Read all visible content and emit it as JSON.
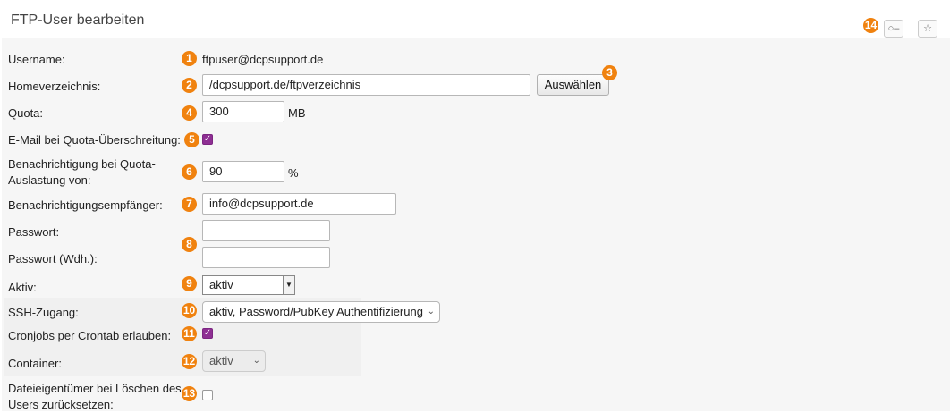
{
  "header": {
    "title": "FTP-User bearbeiten",
    "badge_14": "14"
  },
  "form": {
    "username": {
      "label": "Username:",
      "badge": "1",
      "value": "ftpuser@dcpsupport.de"
    },
    "home": {
      "label": "Homeverzeichnis:",
      "badge": "2",
      "value": "/dcpsupport.de/ftpverzeichnis",
      "button": "Auswählen",
      "button_badge": "3"
    },
    "quota": {
      "label": "Quota:",
      "badge": "4",
      "value": "300",
      "unit": "MB"
    },
    "quota_mail": {
      "label": "E-Mail bei Quota-Überschreitung:",
      "badge": "5",
      "checked": true
    },
    "notify_threshold": {
      "label_line1": "Benachrichtigung bei Quota-",
      "label_line2": "Auslastung von:",
      "badge": "6",
      "value": "90",
      "unit": "%"
    },
    "notify_recipient": {
      "label": "Benachrichtigungsempfänger:",
      "badge": "7",
      "value": "info@dcpsupport.de"
    },
    "password": {
      "label": "Passwort:",
      "badge": "8",
      "value": ""
    },
    "password_repeat": {
      "label": "Passwort (Wdh.):",
      "value": ""
    },
    "active": {
      "label": "Aktiv:",
      "badge": "9",
      "value": "aktiv"
    },
    "ssh": {
      "label": "SSH-Zugang:",
      "badge": "10",
      "value": "aktiv, Password/PubKey Authentifizierung"
    },
    "cron": {
      "label": "Cronjobs per Crontab erlauben:",
      "badge": "11",
      "checked": true
    },
    "container": {
      "label": "Container:",
      "badge": "12",
      "value": "aktiv"
    },
    "reset_owner": {
      "label_line1": "Dateieigentümer bei Löschen des",
      "label_line2": "Users zurücksetzen:",
      "badge": "13",
      "checked": false
    }
  },
  "icons": [
    "key-icon",
    "star-icon"
  ],
  "colors": {
    "badge": "#f0820f",
    "checkbox": "#8e2f93"
  }
}
